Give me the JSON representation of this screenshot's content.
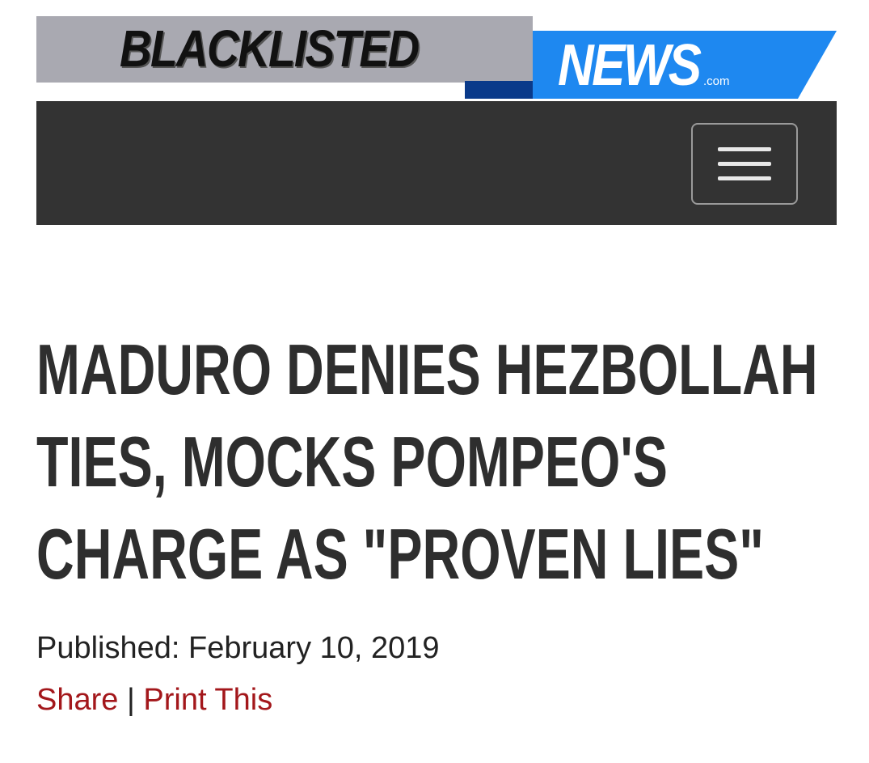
{
  "logo": {
    "word1": "BLACKLISTED",
    "word2": "NEWS",
    "suffix": ".com",
    "colors": {
      "gray_panel": "#a9a9b1",
      "blue_panel": "#1e88f0",
      "dark_blue_accent": "#0a3a8a"
    }
  },
  "navbar": {
    "background": "#333333",
    "menu_icon": "hamburger-menu-icon"
  },
  "article": {
    "headline_lines": [
      "MADURO DENIES HEZBOLLAH",
      "TIES, MOCKS POMPEO'S",
      "CHARGE AS \"PROVEN LIES\""
    ],
    "published_label": "Published:",
    "published_date": "February 10, 2019",
    "share_label": "Share",
    "separator": "|",
    "print_label": "Print This",
    "link_color": "#a3171b"
  }
}
